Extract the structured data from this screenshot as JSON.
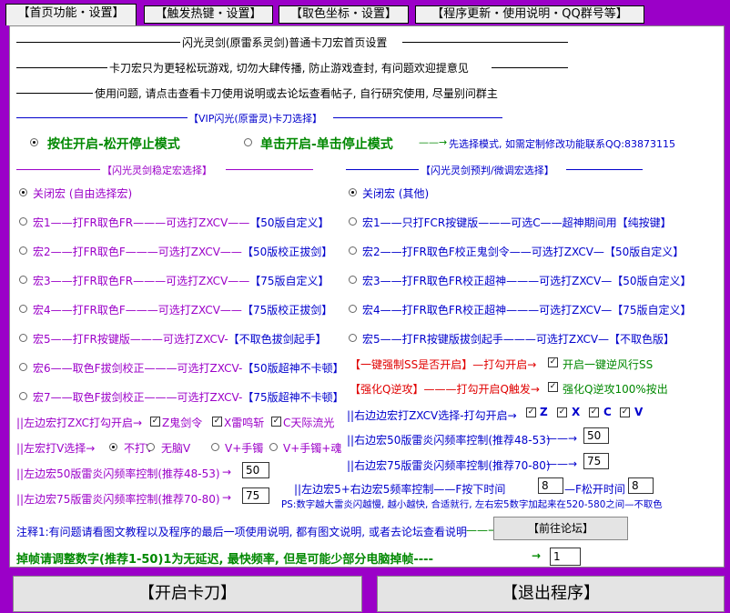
{
  "tabs": [
    {
      "label": "【首页功能・设置】",
      "active": true
    },
    {
      "label": "【触发热键・设置】",
      "active": false
    },
    {
      "label": "【取色坐标・设置】",
      "active": false
    },
    {
      "label": "【程序更新・使用说明・QQ群号等】",
      "active": false
    }
  ],
  "header": {
    "title": "闪光灵剑(原雷系灵剑)普通卡刀宏首页设置",
    "notice1": "卡刀宏只为更轻松玩游戏, 切勿大肆传播, 防止游戏查封, 有问题欢迎提意见",
    "notice2": "使用问题, 请点击查看卡刀使用说明或去论坛查看帖子, 自行研究使用, 尽量别问群主"
  },
  "vip": {
    "title": "【VIP闪光(原雷灵)卡刀选择】",
    "mode_hold": "按住开启-松开停止模式",
    "mode_click": "单击开启-单击停止模式",
    "hint": "先选择模式, 如需定制修改功能联系QQ:83873115"
  },
  "left_group": {
    "title": "【闪光灵剑稳定宏选择】",
    "off_label": "关闭宏 (自由选择宏)",
    "items": [
      {
        "a": "宏1——打FR取色FR———可选打ZXCV——",
        "b": "【50版自定义】"
      },
      {
        "a": "宏2——打FR取色F———可选打ZXCV——",
        "b": "【50版校正拔剑】"
      },
      {
        "a": "宏3——打FR取色FR———可选打ZXCV——",
        "b": "【75版自定义】"
      },
      {
        "a": "宏4——打FR取色F———可选打ZXCV——",
        "b": "【75版校正拔剑】"
      },
      {
        "a": "宏5——打FR按键版———可选打ZXCV-",
        "b": "【不取色拔剑起手】"
      },
      {
        "a": "宏6——取色F拔剑校正———可选打ZXCV-",
        "b": "【50版超神不卡顿】"
      },
      {
        "a": "宏7——取色F拔剑校正———可选打ZXCV-",
        "b": "【75版超神不卡顿】"
      }
    ],
    "zxc_label": "||左边宏打ZXC打勾开启→",
    "zxc_opts": [
      "Z鬼剑令",
      "X雷鸣斩",
      "C天际流光"
    ],
    "v_label": "||左宏打V选择→",
    "v_opts": [
      "不打V",
      "无脑V",
      "V+手镯",
      "V+手镯+魂"
    ],
    "freq50_label": "||左边宏50版雷炎闪频率控制(推荐48-53)",
    "freq50_value": "50",
    "freq75_label": "||左边宏75版雷炎闪频率控制(推荐70-80)",
    "freq75_value": "75"
  },
  "right_group": {
    "title": "【闪光灵剑预判/微调宏选择】",
    "off_label": "关闭宏 (其他)",
    "items": [
      {
        "a": "宏1——只打FCR按键版———可选C——超神期间用",
        "b": "【纯按键】"
      },
      {
        "a": "宏2——打FR取色F校正鬼剑令——可选打ZXCV—",
        "b": "【50版自定义】"
      },
      {
        "a": "宏3——打FR取色FR校正超神———可选打ZXCV—",
        "b": "【50版自定义】"
      },
      {
        "a": "宏4——打FR取色FR校正超神———可选打ZXCV—",
        "b": "【75版自定义】"
      },
      {
        "a": "宏5——打FR按键版拔剑起手———可选打ZXCV—",
        "b": "【不取色版】"
      }
    ],
    "ss_label": "【一键强制SS是否开启】—打勾开启→",
    "ss_check_label": "开启一键逆风行SS",
    "qnx_label": "【强化Q逆攻】———打勾开启Q触发→",
    "qnx_check_label": "强化Q逆攻100%按出",
    "zxcv_label": "||右边边宏打ZXCV选择-打勾开启→",
    "zxcv_opts": [
      "Z",
      "X",
      "C",
      "V"
    ],
    "freq50_label": "||右边宏50版雷炎闪频率控制(推荐48-53)",
    "freq50_value": "50",
    "freq75_label": "||右边宏75版雷炎闪频率控制(推荐70-80)",
    "freq75_value": "75",
    "key5_label": "||左边宏5+右边宏5频率控制——F按下时间",
    "key5_down": "8",
    "key5_up_label": "—F松开时间",
    "key5_up": "8",
    "ps": "PS:数字越大雷炎闪越慢, 越小越快, 合适就行, 左右宏5数字加起来在520-580之间—不取色"
  },
  "footer": {
    "note": "注释1:有问题请看图文教程以及程序的最后一项使用说明, 都有图文说明, 或者去论坛查看说明",
    "forum_button": "【前往论坛】",
    "frame_label": "掉帧请调整数字(推荐1-50)1为无延迟, 最快频率, 但是可能少部分电脑掉帧----",
    "frame_value": "1",
    "start_button": "【开启卡刀】",
    "exit_button": "【退出程序】"
  },
  "colors": {
    "bg": "#9b00c8",
    "blue": "#0000cc",
    "red": "#e00000",
    "green": "#008800"
  }
}
